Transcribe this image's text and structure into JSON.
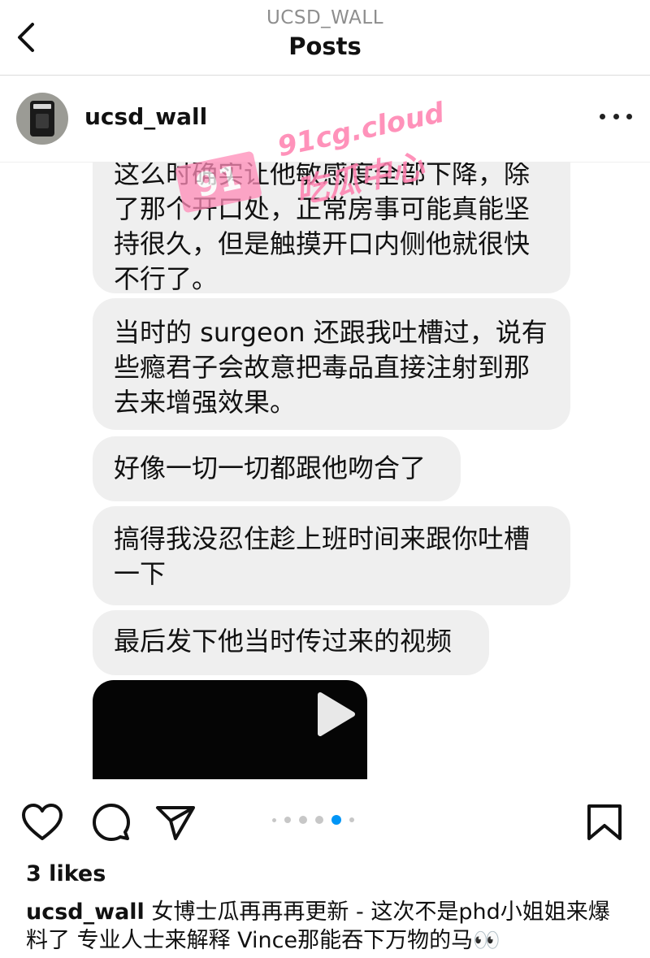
{
  "header": {
    "account": "UCSD_WALL",
    "title": "Posts",
    "back_icon": "chevron-left-icon"
  },
  "post": {
    "username": "ucsd_wall",
    "more_icon": "ellipsis-icon"
  },
  "watermark": {
    "box_text": "91",
    "url": "91cg.cloud",
    "name": "吃瓜中心"
  },
  "messages": [
    "这么时确实让他敏感度全部下降，除了那个开口处，正常房事可能真能坚持很久，但是触摸开口内侧他就很快不行了。",
    "当时的 surgeon 还跟我吐槽过，说有些瘾君子会故意把毒品直接注射到那去来增强效果。",
    "好像一切一切都跟他吻合了",
    "搞得我没忍住趁上班时间来跟你吐槽一下",
    "最后发下他当时传过来的视频"
  ],
  "video": {
    "icon": "play-icon"
  },
  "actions": {
    "icons": [
      "heart-icon",
      "comment-icon",
      "share-icon",
      "bookmark-icon"
    ],
    "carousel_total": 6,
    "carousel_active": 5,
    "colors": {
      "active_dot": "#0095f6",
      "inactive_dot": "#c7c7c7"
    }
  },
  "likes": "3 likes",
  "caption": {
    "username": "ucsd_wall",
    "text": "女博士瓜再再再更新 - 这次不是phd小姐姐来爆料了 专业人士来解释 Vince那能吞下万物的马👀"
  }
}
